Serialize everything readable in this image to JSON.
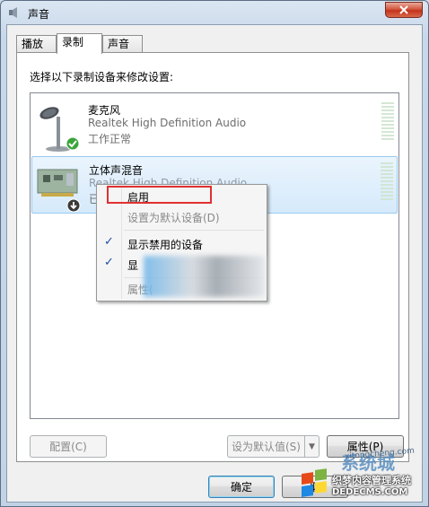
{
  "window": {
    "title": "声音"
  },
  "tabs": [
    {
      "label": "播放"
    },
    {
      "label": "录制"
    },
    {
      "label": "声音"
    }
  ],
  "instruction": "选择以下录制设备来修改设置:",
  "devices": [
    {
      "name": "麦克风",
      "description": "Realtek High Definition Audio",
      "status": "工作正常",
      "icon": "microphone-icon",
      "badge": "check-badge-icon"
    },
    {
      "name": "立体声混音",
      "description": "Realtek High Definition Audio",
      "status": "已",
      "icon": "sound-card-icon",
      "badge": "disabled-badge-icon"
    }
  ],
  "context_menu": {
    "items": [
      {
        "label": "启用",
        "enabled": true,
        "checked": false
      },
      {
        "label": "设置为默认设备(D)",
        "enabled": false,
        "checked": false
      },
      {
        "label": "显示禁用的设备",
        "enabled": true,
        "checked": true
      },
      {
        "label": "显",
        "enabled": true,
        "checked": true
      },
      {
        "label": "属性(",
        "enabled": false,
        "checked": false
      }
    ]
  },
  "buttons": {
    "configure": "配置(C)",
    "set_default": "设为默认值(S)",
    "properties": "属性(P)",
    "ok": "确定",
    "cancel": "取"
  },
  "watermark": {
    "brand_big": "系统城",
    "url_small": "xitongcheng.com",
    "line1": "织梦内容管理系统",
    "line2": "DEDECMS.COM"
  },
  "colors": {
    "selection": "#d6eafb",
    "highlight_box": "#e03030",
    "close_button": "#c2331a"
  }
}
